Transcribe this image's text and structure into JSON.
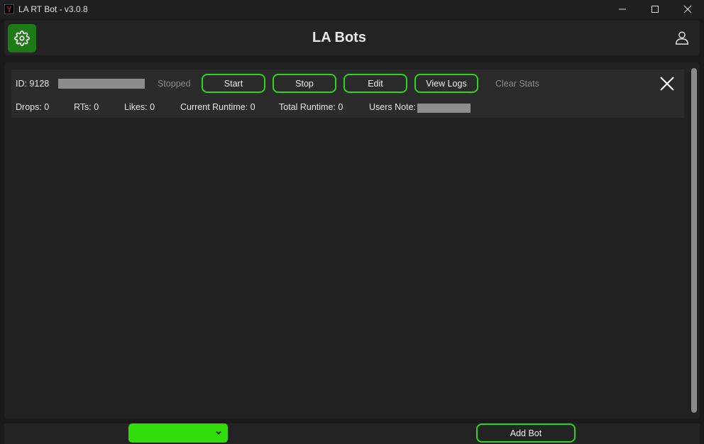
{
  "window": {
    "title": "LA RT Bot - v3.0.8",
    "icons": [
      "app-icon",
      "minimize-icon",
      "maximize-icon",
      "close-icon"
    ]
  },
  "header": {
    "title": "LA Bots",
    "settings_icon": "gear-icon",
    "user_icon": "user-icon"
  },
  "bot": {
    "id_label": "ID: 9128",
    "status": "Stopped",
    "buttons": {
      "start": "Start",
      "stop": "Stop",
      "edit": "Edit",
      "view_logs": "View Logs"
    },
    "clear_stats": "Clear Stats",
    "stats": {
      "drops": "Drops: 0",
      "rts": "RTs: 0",
      "likes": "Likes: 0",
      "current_runtime": "Current Runtime: 0",
      "total_runtime": "Total Runtime: 0",
      "users_note": "Users Note:"
    }
  },
  "footer": {
    "add_bot": "Add Bot"
  },
  "colors": {
    "accent": "#2fd51a",
    "settings_bg": "#1e7a16",
    "select_bg": "#2fdc08",
    "background": "#1a1a1a"
  }
}
